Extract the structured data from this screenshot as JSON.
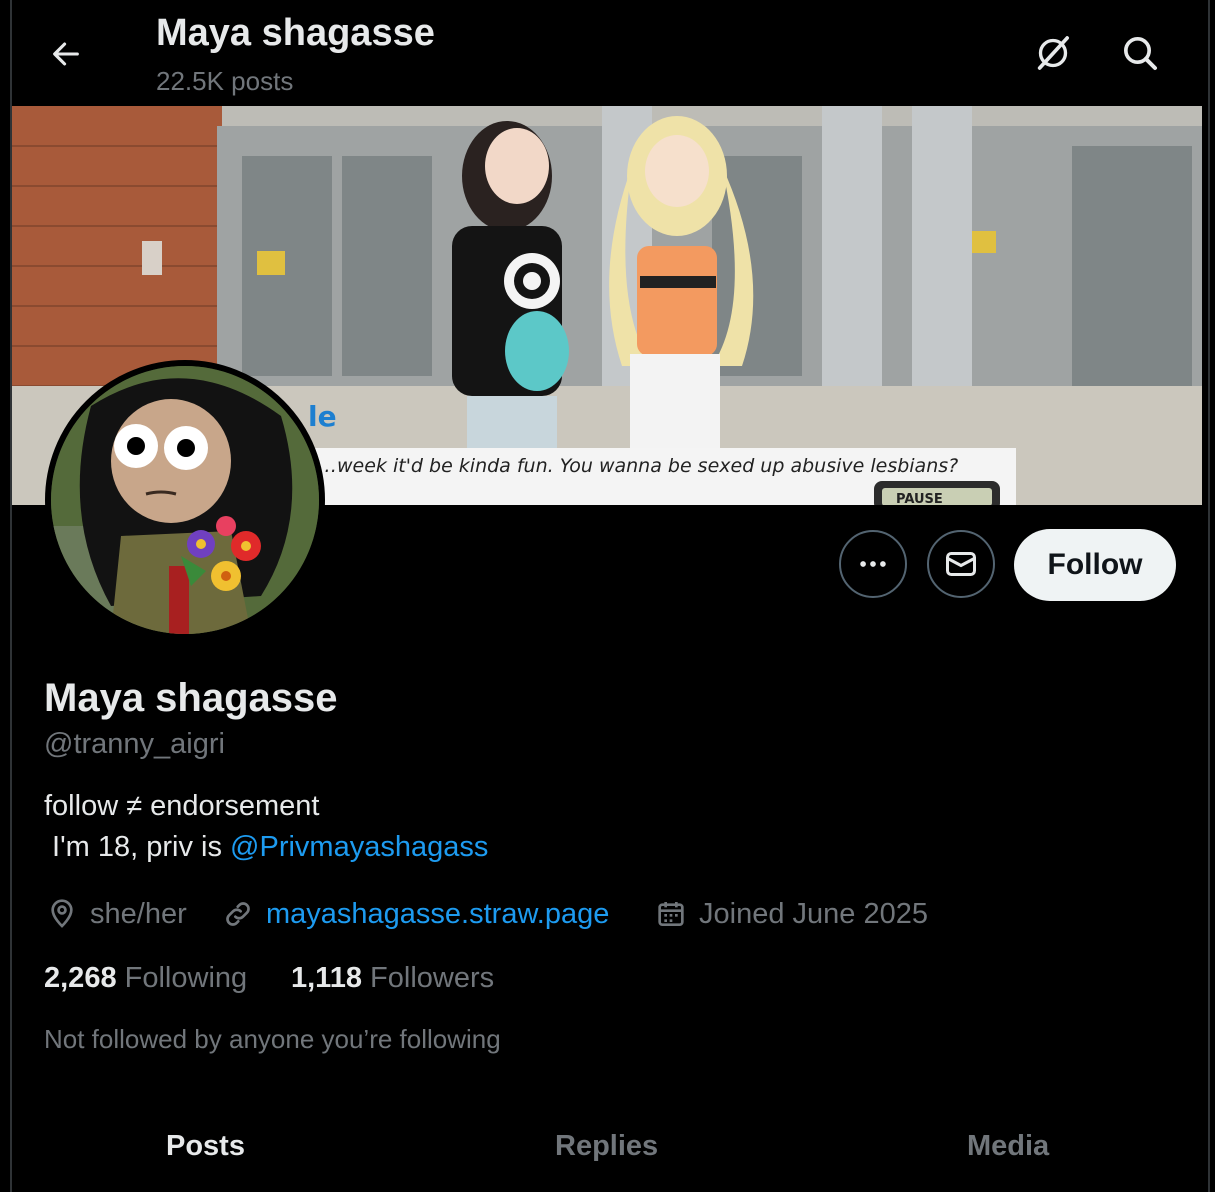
{
  "header": {
    "title": "Maya shagasse",
    "posts_count": "22.5K posts"
  },
  "banner": {
    "caption": "…week it'd be kinda fun. You wanna be sexed up abusive lesbians?",
    "speaker_fragment": "le",
    "pause_label": "PAUSE"
  },
  "actions": {
    "more_label": "More",
    "message_label": "Message",
    "follow_label": "Follow"
  },
  "profile": {
    "display_name": "Maya shagasse",
    "handle": "@tranny_aigri",
    "bio_line1": "follow ≠ endorsement",
    "bio_line2_prefix": " I'm 18, priv is ",
    "bio_line2_mention": "@Privmayashagass",
    "pronouns": "she/her",
    "website": "mayashagasse.straw.page",
    "joined": "Joined June 2025",
    "following_count": "2,268",
    "following_label": "Following",
    "followers_count": "1,118",
    "followers_label": "Followers",
    "mutuals_note": "Not followed by anyone you’re following"
  },
  "tabs": [
    {
      "label": "Posts",
      "active": true
    },
    {
      "label": "Replies",
      "active": false
    },
    {
      "label": "Media",
      "active": false
    }
  ],
  "colors": {
    "background": "#000000",
    "primary_text": "#e7e9ea",
    "secondary_text": "#71767b",
    "link": "#1d9bf0",
    "follow_button_bg": "#eff3f4",
    "border": "#536471"
  },
  "icons": [
    "back-arrow-icon",
    "no-grok-icon",
    "search-icon",
    "more-icon",
    "mail-icon",
    "location-icon",
    "link-icon",
    "calendar-icon"
  ]
}
